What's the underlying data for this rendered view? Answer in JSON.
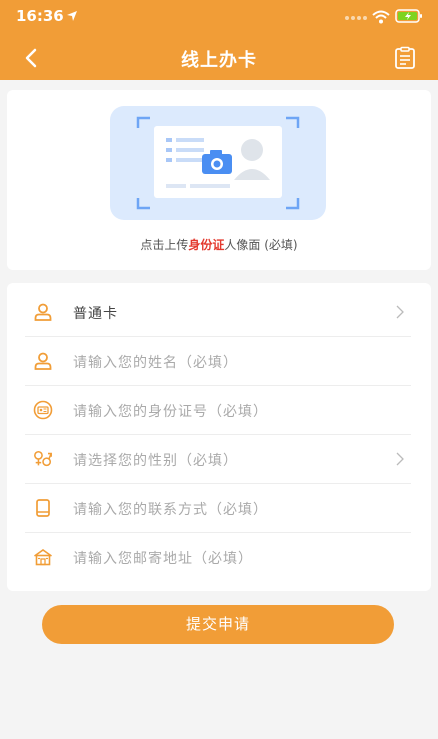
{
  "status_bar": {
    "time": "16:36"
  },
  "nav": {
    "title": "线上办卡"
  },
  "upload": {
    "hint_prefix": "点击上传",
    "hint_highlight": "身份证",
    "hint_suffix": "人像面 (必填)"
  },
  "form": {
    "rows": [
      {
        "label": "普通卡",
        "icon": "user-icon",
        "has_chevron": true
      },
      {
        "label": "请输入您的姓名（必填）",
        "icon": "user-icon",
        "has_chevron": false
      },
      {
        "label": "请输入您的身份证号（必填）",
        "icon": "id-card-icon",
        "has_chevron": false
      },
      {
        "label": "请选择您的性别（必填）",
        "icon": "gender-icon",
        "has_chevron": true
      },
      {
        "label": "请输入您的联系方式（必填）",
        "icon": "phone-icon",
        "has_chevron": false
      },
      {
        "label": "请输入您邮寄地址（必填）",
        "icon": "house-icon",
        "has_chevron": false
      }
    ]
  },
  "submit": {
    "label": "提交申请"
  },
  "colors": {
    "brand": "#f19d37",
    "highlight": "#e3392e",
    "background": "#f4f4f4"
  }
}
